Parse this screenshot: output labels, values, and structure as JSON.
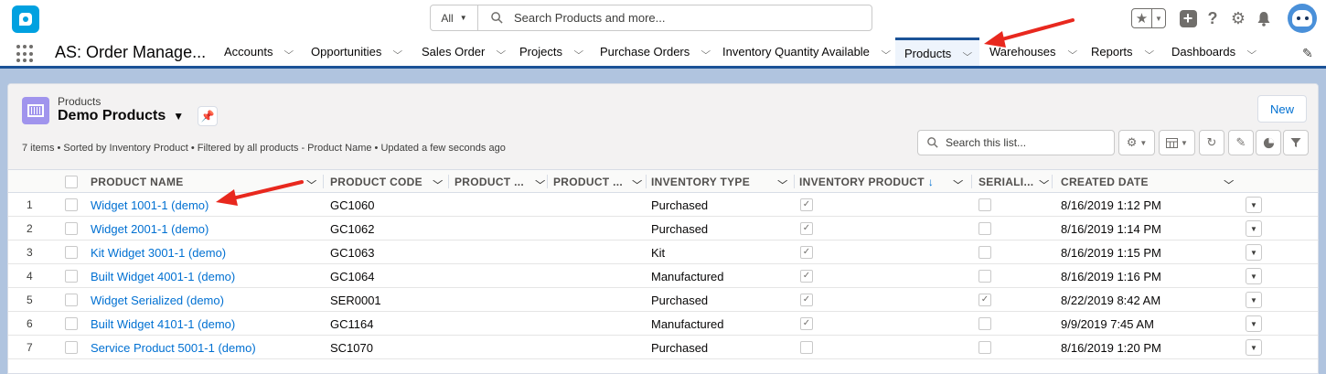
{
  "global_header": {
    "search_scope": "All",
    "search_placeholder": "Search Products and more..."
  },
  "nav": {
    "app_name": "AS: Order Manage...",
    "items": [
      {
        "label": "Accounts"
      },
      {
        "label": "Opportunities"
      },
      {
        "label": "Sales Order"
      },
      {
        "label": "Projects"
      },
      {
        "label": "Purchase Orders"
      },
      {
        "label": "Inventory Quantity Available"
      },
      {
        "label": "Products",
        "active": true
      },
      {
        "label": "Warehouses"
      },
      {
        "label": "Reports"
      },
      {
        "label": "Dashboards"
      }
    ]
  },
  "list_view": {
    "object_label": "Products",
    "view_name": "Demo Products",
    "new_button": "New",
    "info": "7 items • Sorted by Inventory Product • Filtered by all products - Product Name • Updated a few seconds ago",
    "search_placeholder": "Search this list..."
  },
  "table": {
    "columns": [
      "PRODUCT NAME",
      "PRODUCT CODE",
      "PRODUCT ...",
      "PRODUCT ...",
      "INVENTORY TYPE",
      "INVENTORY PRODUCT",
      "SERIALI...",
      "CREATED DATE"
    ],
    "sort_indicator": "↓",
    "rows": [
      {
        "num": "1",
        "name": "Widget 1001-1 (demo)",
        "code": "GC1060",
        "type": "Purchased",
        "inventory": true,
        "serialized": false,
        "created": "8/16/2019 1:12 PM"
      },
      {
        "num": "2",
        "name": "Widget 2001-1 (demo)",
        "code": "GC1062",
        "type": "Purchased",
        "inventory": true,
        "serialized": false,
        "created": "8/16/2019 1:14 PM"
      },
      {
        "num": "3",
        "name": "Kit Widget 3001-1 (demo)",
        "code": "GC1063",
        "type": "Kit",
        "inventory": true,
        "serialized": false,
        "created": "8/16/2019 1:15 PM"
      },
      {
        "num": "4",
        "name": "Built Widget 4001-1 (demo)",
        "code": "GC1064",
        "type": "Manufactured",
        "inventory": true,
        "serialized": false,
        "created": "8/16/2019 1:16 PM"
      },
      {
        "num": "5",
        "name": "Widget Serialized (demo)",
        "code": "SER0001",
        "type": "Purchased",
        "inventory": true,
        "serialized": true,
        "created": "8/22/2019 8:42 AM"
      },
      {
        "num": "6",
        "name": "Built Widget 4101-1 (demo)",
        "code": "GC1164",
        "type": "Manufactured",
        "inventory": true,
        "serialized": false,
        "created": "9/9/2019 7:45 AM"
      },
      {
        "num": "7",
        "name": "Service Product 5001-1 (demo)",
        "code": "SC1070",
        "type": "Purchased",
        "inventory": false,
        "serialized": false,
        "created": "8/16/2019 1:20 PM"
      }
    ]
  },
  "colors": {
    "brand_blue": "#1b5297",
    "link_blue": "#0070d2",
    "annotation_arrow": "#e8281e"
  }
}
